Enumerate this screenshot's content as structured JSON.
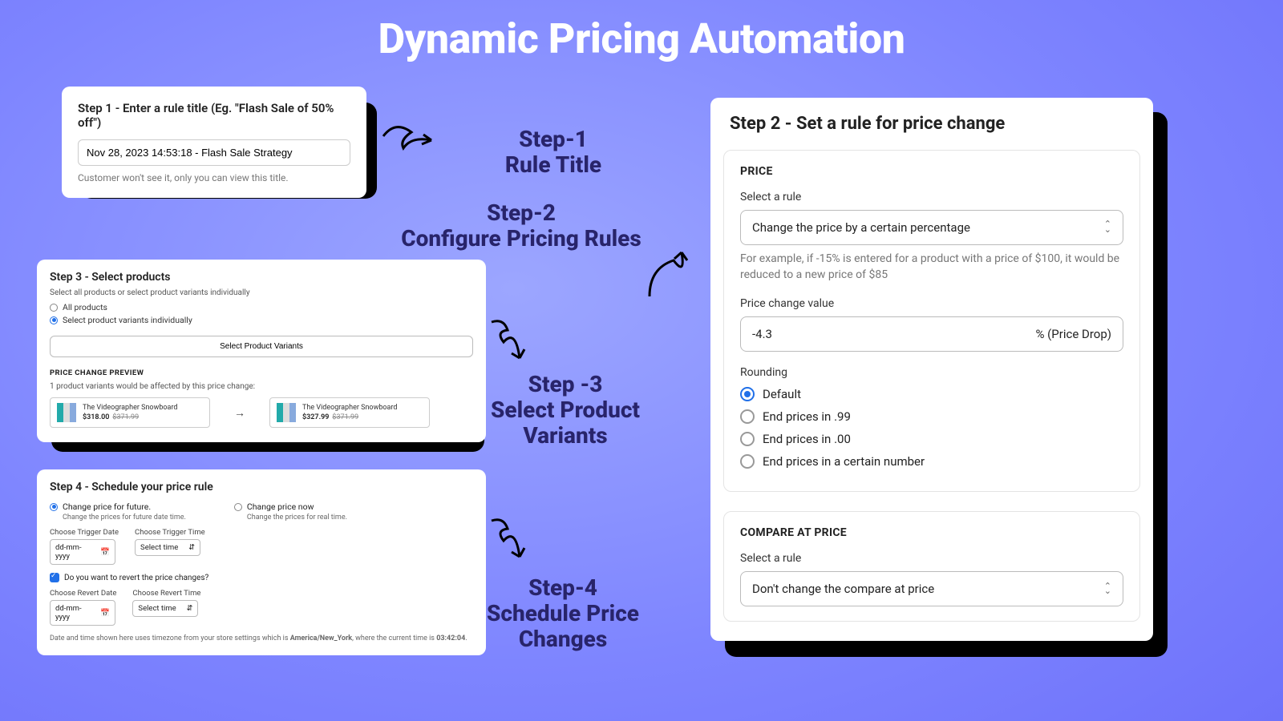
{
  "title": "Dynamic Pricing Automation",
  "labels": {
    "s1a": "Step-1",
    "s1b": "Rule Title",
    "s2a": "Step-2",
    "s2b": "Configure Pricing Rules",
    "s3a": "Step -3",
    "s3b": "Select Product Variants",
    "s4a": "Step-4",
    "s4b": "Schedule Price Changes"
  },
  "step1": {
    "heading": "Step 1 - Enter a rule title (Eg. \"Flash Sale of 50% off\")",
    "value": "Nov 28, 2023 14:53:18 - Flash Sale Strategy",
    "note": "Customer won't see it, only you can view this title."
  },
  "step2": {
    "heading": "Step 2 - Set a rule for price change",
    "price_section": "PRICE",
    "select_label": "Select a rule",
    "rule_option": "Change the price by a certain percentage",
    "rule_note": "For example, if -15% is entered for a product with a price of $100, it would be reduced to a new price of $85",
    "change_label": "Price change value",
    "change_value": "-4.3",
    "change_unit": "% (Price Drop)",
    "rounding_label": "Rounding",
    "rounding": [
      "Default",
      "End prices in .99",
      "End prices in .00",
      "End prices in a certain number"
    ],
    "compare_section": "COMPARE AT PRICE",
    "compare_option": "Don't change the compare at price"
  },
  "step3": {
    "heading": "Step 3 - Select products",
    "sub": "Select all products or select product variants individually",
    "opts": [
      "All products",
      "Select product variants individually"
    ],
    "btn": "Select Product Variants",
    "preview_title": "PRICE CHANGE PREVIEW",
    "preview_sub": "1 product variants would be affected by this price change:",
    "prod_name": "The Videographer Snowboard",
    "before_price": "$318.00",
    "before_old": "$371.99",
    "after_price": "$327.99",
    "after_old": "$371.99"
  },
  "step4": {
    "heading": "Step 4 - Schedule your price rule",
    "opt1": "Change price for future.",
    "opt1_sub": "Change the prices for future date time.",
    "opt2": "Change price now",
    "opt2_sub": "Change the prices for real time.",
    "trigger_date_lbl": "Choose Trigger Date",
    "trigger_time_lbl": "Choose Trigger Time",
    "date_ph": "dd-mm-yyyy",
    "time_ph": "Select time",
    "revert_chk": "Do you want to revert the price changes?",
    "revert_date_lbl": "Choose Revert Date",
    "revert_time_lbl": "Choose Revert Time",
    "tz": "America/New_York",
    "now": "03:42:04",
    "tz_prefix": "Date and time shown here uses timezone from your store settings which is ",
    "tz_mid": ", where the current time is ",
    "tz_suffix": "."
  }
}
